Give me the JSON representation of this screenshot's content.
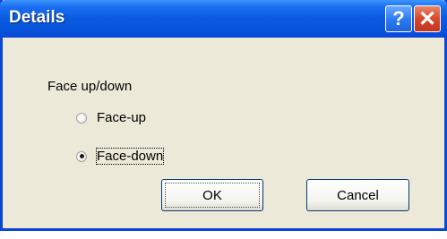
{
  "dialog": {
    "title": "Details",
    "help_glyph": "?",
    "close_glyph": "✕",
    "group_label": "Face up/down",
    "options": [
      {
        "label": "Face-up",
        "selected": false
      },
      {
        "label": "Face-down",
        "selected": true
      }
    ],
    "ok_label": "OK",
    "cancel_label": "Cancel"
  },
  "icons": {
    "help": "question-mark-icon",
    "close": "close-x-icon"
  },
  "colors": {
    "titlebar": "#0a5ae0",
    "close_button": "#d9472b",
    "dialog_background": "#ece9d8"
  }
}
